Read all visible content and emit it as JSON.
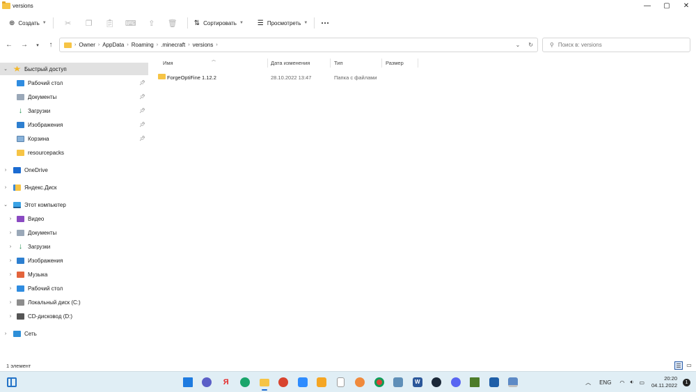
{
  "window": {
    "title": "versions",
    "minimize": "—",
    "maximize": "▢",
    "close": "✕"
  },
  "toolbar": {
    "new_label": "Создать",
    "sort_label": "Сортировать",
    "view_label": "Просмотреть",
    "more_label": "···"
  },
  "address": {
    "crumbs": [
      "Owner",
      "AppData",
      "Roaming",
      ".minecraft",
      "versions"
    ],
    "search_placeholder": "Поиск в: versions"
  },
  "sidebar": {
    "quick_access": "Быстрый доступ",
    "quick_items": [
      "Рабочий стол",
      "Документы",
      "Загрузки",
      "Изображения",
      "Корзина",
      "resourcepacks"
    ],
    "onedrive": "OneDrive",
    "yandex": "Яндекс.Диск",
    "this_pc": "Этот компьютер",
    "pc_items": [
      "Видео",
      "Документы",
      "Загрузки",
      "Изображения",
      "Музыка",
      "Рабочий стол",
      "Локальный диск (C:)",
      "CD-дисковод (D:)"
    ],
    "network": "Сеть"
  },
  "columns": {
    "name": "Имя",
    "modified": "Дата изменения",
    "type": "Тип",
    "size": "Размер"
  },
  "files": [
    {
      "name": "ForgeOptiFine 1.12.2",
      "modified": "28.10.2022 13:47",
      "type": "Папка с файлами",
      "size": ""
    }
  ],
  "status": {
    "count": "1 элемент"
  },
  "taskbar": {
    "lang": "ENG",
    "time": "20:20",
    "date": "04.11.2022",
    "notifications": "1"
  }
}
